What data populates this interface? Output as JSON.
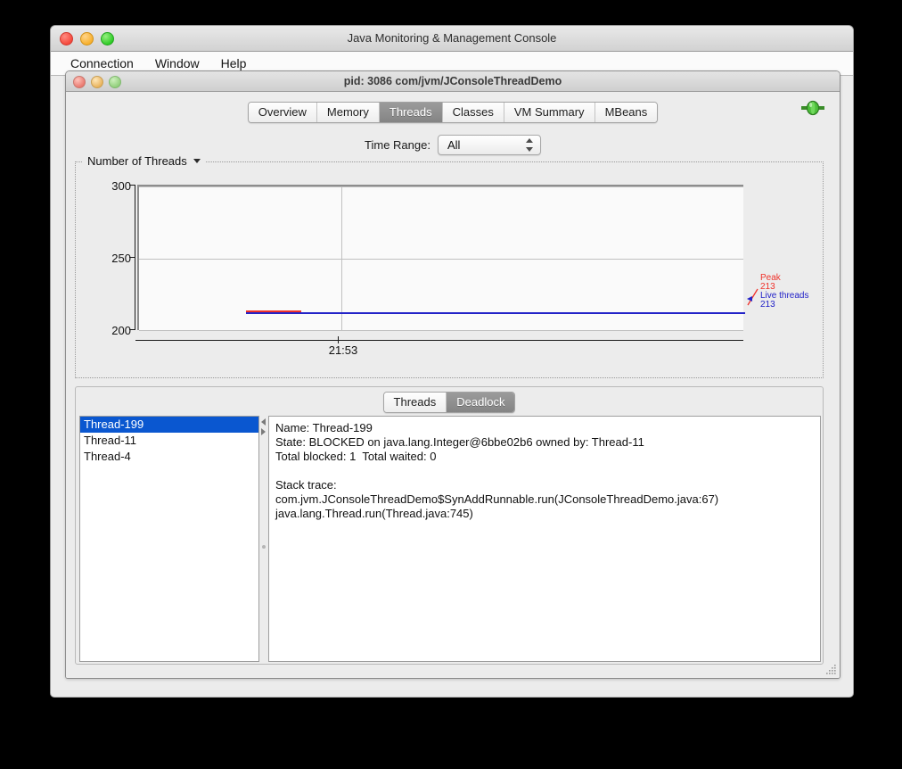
{
  "outer_window": {
    "title": "Java Monitoring & Management Console",
    "traffic_lights": [
      "close-button",
      "minimize-button",
      "maximize-button"
    ],
    "menubar": [
      {
        "label": "Connection",
        "name": "menu-connection"
      },
      {
        "label": "Window",
        "name": "menu-window"
      },
      {
        "label": "Help",
        "name": "menu-help"
      }
    ]
  },
  "inner_window": {
    "title": "pid: 3086 com/jvm/JConsoleThreadDemo",
    "tabs": [
      {
        "label": "Overview",
        "selected": false
      },
      {
        "label": "Memory",
        "selected": false
      },
      {
        "label": "Threads",
        "selected": true
      },
      {
        "label": "Classes",
        "selected": false
      },
      {
        "label": "VM Summary",
        "selected": false
      },
      {
        "label": "MBeans",
        "selected": false
      }
    ],
    "connection_indicator": "connected-plug-icon"
  },
  "time_range": {
    "label": "Time Range:",
    "value": "All"
  },
  "chart_group": {
    "title": "Number of Threads",
    "dropdown_icon": "chevron-down-icon"
  },
  "chart_data": {
    "type": "line",
    "title": "Number of Threads",
    "xlabel": "",
    "ylabel": "",
    "ylim": [
      200,
      300
    ],
    "yticks": [
      300,
      250,
      200
    ],
    "xticks": [
      "21:53"
    ],
    "grid": true,
    "legend_position": "right-outside",
    "series": [
      {
        "name": "Peak",
        "color": "#f0322a",
        "current_value": 213,
        "label": "Peak",
        "value_label": "213"
      },
      {
        "name": "Live threads",
        "color": "#2323c8",
        "current_value": 213,
        "label": "Live threads",
        "value_label": "213"
      }
    ]
  },
  "bottom_panel": {
    "tabs": [
      {
        "label": "Threads",
        "selected": false
      },
      {
        "label": "Deadlock",
        "selected": true
      }
    ],
    "thread_list": [
      {
        "label": "Thread-199",
        "selected": true
      },
      {
        "label": "Thread-11",
        "selected": false
      },
      {
        "label": "Thread-4",
        "selected": false
      }
    ],
    "detail_lines": [
      "Name: Thread-199",
      "State: BLOCKED on java.lang.Integer@6bbe02b6 owned by: Thread-11",
      "Total blocked: 1  Total waited: 0",
      "",
      "Stack trace:",
      "com.jvm.JConsoleThreadDemo$SynAddRunnable.run(JConsoleThreadDemo.java:67)",
      "java.lang.Thread.run(Thread.java:745)"
    ]
  },
  "colors": {
    "peak": "#f0322a",
    "live": "#2323c8",
    "selection": "#0a57d0",
    "window_bg": "#ececec"
  }
}
